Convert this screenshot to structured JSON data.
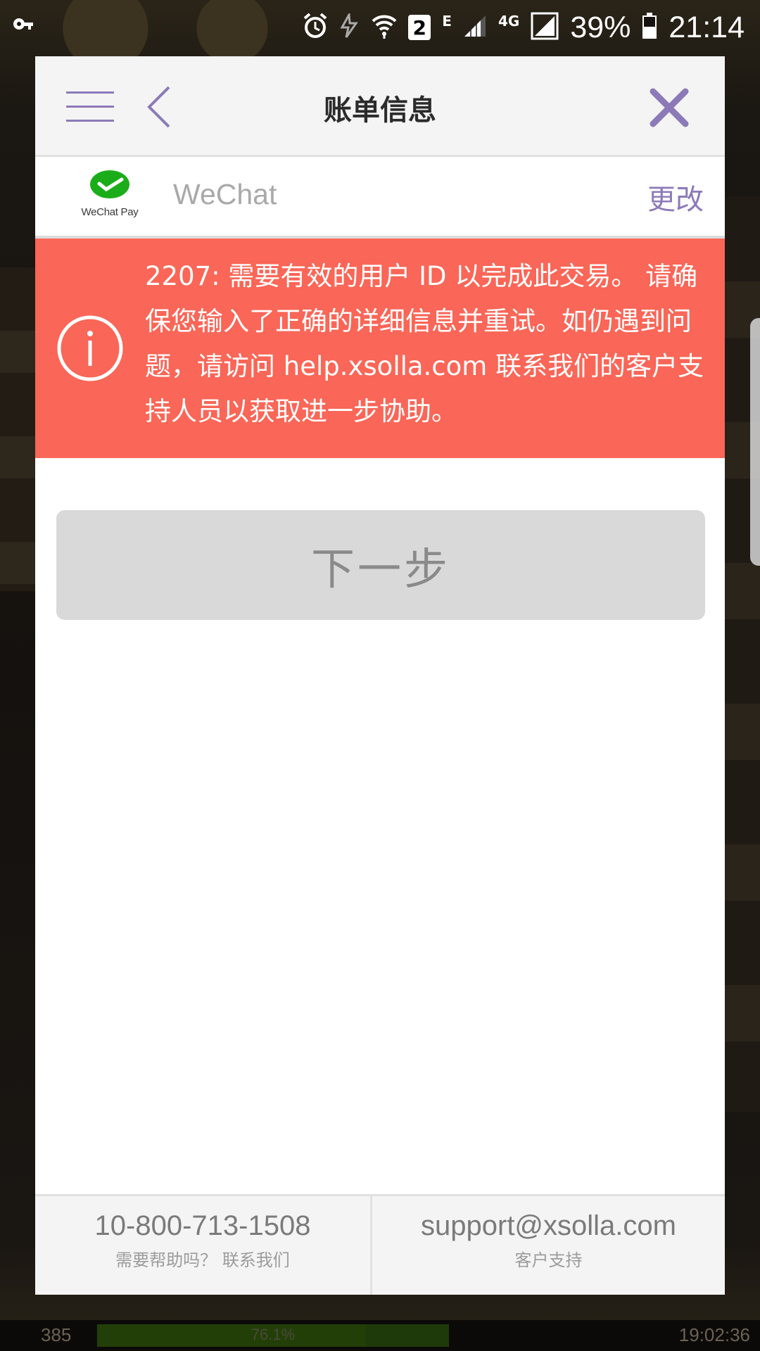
{
  "statusbar": {
    "network_e": "E",
    "network_4g": "4G",
    "sim_badge": "2",
    "battery": "39%",
    "time": "21:14"
  },
  "modal": {
    "title": "账单信息",
    "payment_method": {
      "logo_caption": "WeChat Pay",
      "name": "WeChat",
      "change_label": "更改"
    },
    "error": {
      "message": "2207: 需要有效的用户 ID 以完成此交易。 请确保您输入了正确的详细信息并重试。如仍遇到问题，请访问 help.xsolla.com 联系我们的客户支持人员以获取进一步协助。"
    },
    "next_button": "下一步",
    "footer": {
      "phone": "10-800-713-1508",
      "phone_caption": "需要帮助吗？ 联系我们",
      "email": "support@xsolla.com",
      "email_caption": "客户支持"
    }
  },
  "gamebar": {
    "left_value": "385",
    "progress_text": "76.1%",
    "progress": 0.761,
    "timer": "19:02:36"
  },
  "colors": {
    "accent": "#8c7ab8",
    "error_bg": "#fa6657",
    "wechat_green": "#1aad19"
  }
}
